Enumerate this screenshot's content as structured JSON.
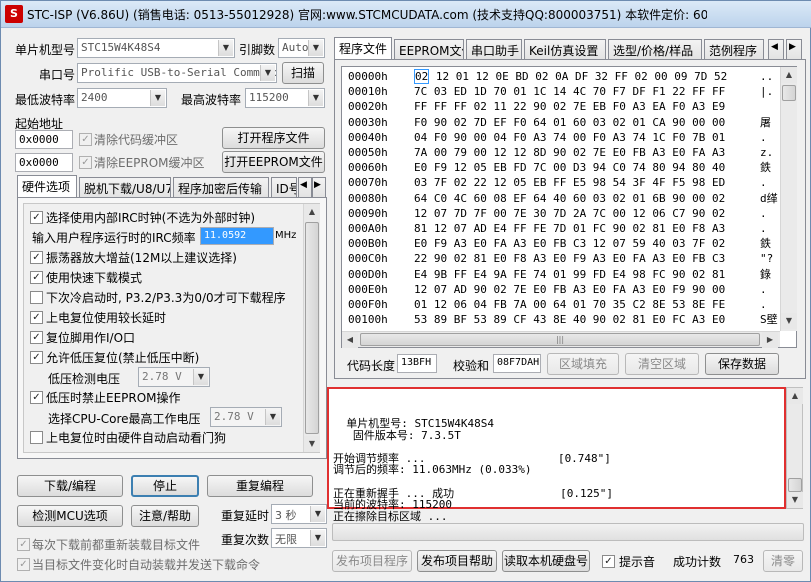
{
  "title": "STC-ISP (V6.86U) (销售电话: 0513-55012928) 官网:www.STCMCUDATA.com (技术支持QQ:800003751) 本软件定价: 60...",
  "title_icon": "stc-logo-icon",
  "left": {
    "mcu_type_label": "单片机型号",
    "mcu_type_value": "STC15W4K48S4",
    "pin_label": "引脚数",
    "pin_value": "Auto",
    "port_label": "串口号",
    "port_value": "Prolific USB-to-Serial Comm Po",
    "scan_button": "扫描",
    "min_baud_label": "最低波特率",
    "min_baud_value": "2400",
    "max_baud_label": "最高波特率",
    "max_baud_value": "115200",
    "start_addr_label": "起始地址",
    "addr1_value": "0x0000",
    "clear_code_label": "清除代码缓冲区",
    "open_program_button": "打开程序文件",
    "addr2_value": "0x0000",
    "clear_eeprom_label": "清除EEPROM缓冲区",
    "open_eeprom_button": "打开EEPROM文件",
    "tabs": [
      "硬件选项",
      "脱机下载/U8/U7",
      "程序加密后传输",
      "ID号"
    ],
    "options": [
      {
        "label": "选择使用内部IRC时钟(不选为外部时钟)",
        "checked": true
      },
      {
        "label": "输入用户程序运行时的IRC频率",
        "freq": "11.0592",
        "unit": "MHz"
      },
      {
        "label": "振荡器放大增益(12M以上建议选择)",
        "checked": true
      },
      {
        "label": "使用快速下载模式",
        "checked": true
      },
      {
        "label": "下次冷启动时, P3.2/P3.3为0/0才可下载程序",
        "checked": false
      },
      {
        "label": "上电复位使用较长延时",
        "checked": true
      },
      {
        "label": "复位脚用作I/O口",
        "checked": true
      },
      {
        "label": "允许低压复位(禁止低压中断)",
        "checked": true
      },
      {
        "label": "低压检测电压",
        "value": "2.78 V"
      },
      {
        "label": "低压时禁止EEPROM操作",
        "checked": true
      },
      {
        "label": "选择CPU-Core最高工作电压",
        "value": "2.78 V"
      },
      {
        "label": "上电复位时由硬件自动启动看门狗",
        "checked": false
      }
    ],
    "download_button": "下载/编程",
    "stop_button": "停止",
    "reprogram_button": "重复编程",
    "detect_button": "检测MCU选项",
    "help_button": "注意/帮助",
    "repeat_delay_label": "重复延时",
    "repeat_delay_value": "3 秒",
    "repeat_count_label": "重复次数",
    "repeat_count_value": "无限",
    "reload_label": "每次下载前都重新装载目标文件",
    "auto_send_label": "当目标文件变化时自动装载并发送下载命令"
  },
  "right": {
    "tabs": [
      "程序文件",
      "EEPROM文件",
      "串口助手",
      "Keil仿真设置",
      "选型/价格/样品",
      "范例程序"
    ],
    "hex_rows": [
      {
        "addr": "00000h",
        "bytes": "02 12 01 12 0E BD 02 0A DF 32 FF 02 00 09 7D 52",
        "ascii": ".."
      },
      {
        "addr": "00010h",
        "bytes": "7C 03 ED 1D 70 01 1C 14 4C 70 F7 DF F1 22 FF FF",
        "ascii": "|."
      },
      {
        "addr": "00020h",
        "bytes": "FF FF FF 02 11 22 90 02 7E EB F0 A3 EA F0 A3 E9",
        "ascii": ""
      },
      {
        "addr": "00030h",
        "bytes": "F0 90 02 7D EF F0 64 01 60 03 02 01 CA 90 00 00",
        "ascii": "屠"
      },
      {
        "addr": "00040h",
        "bytes": "04 F0 90 00 04 F0 A3 74 00 F0 A3 74 1C F0 7B 01",
        "ascii": "."
      },
      {
        "addr": "00050h",
        "bytes": "7A 00 79 00 12 12 8D 90 02 7E E0 FB A3 E0 FA A3",
        "ascii": "z."
      },
      {
        "addr": "00060h",
        "bytes": "E0 F9 12 05 EB FD 7C 00 D3 94 C0 74 80 94 80 40",
        "ascii": "鉄"
      },
      {
        "addr": "00070h",
        "bytes": "03 7F 02 22 12 05 EB FF E5 98 54 3F 4F F5 98 ED",
        "ascii": "."
      },
      {
        "addr": "00080h",
        "bytes": "64 C0 4C 60 08 EF 64 40 60 03 02 01 6B 90 00 02",
        "ascii": "d缂"
      },
      {
        "addr": "00090h",
        "bytes": "12 07 7D 7F 00 7E 30 7D 2A 7C 00 12 06 C7 90 02",
        "ascii": "."
      },
      {
        "addr": "000A0h",
        "bytes": "81 12 07 AD E4 FF FE 7D 01 FC 90 02 81 E0 F8 A3",
        "ascii": "."
      },
      {
        "addr": "000B0h",
        "bytes": "E0 F9 A3 E0 FA A3 E0 FB C3 12 07 59 40 03 7F 02",
        "ascii": "鉄"
      },
      {
        "addr": "000C0h",
        "bytes": "22 90 02 81 E0 F8 A3 E0 F9 A3 E0 FA A3 E0 FB C3",
        "ascii": "\"?"
      },
      {
        "addr": "000D0h",
        "bytes": "E4 9B FF E4 9A FE 74 01 99 FD E4 98 FC 90 02 81",
        "ascii": "錄"
      },
      {
        "addr": "000E0h",
        "bytes": "12 07 AD 90 02 7E E0 FB A3 E0 FA A3 E0 F9 90 00",
        "ascii": "."
      },
      {
        "addr": "000F0h",
        "bytes": "01 12 06 04 FB 7A 00 64 01 70 35 C2 8E 53 8E FE",
        "ascii": "."
      },
      {
        "addr": "00100h",
        "bytes": "53 89 BF 53 89 CF 43 8E 40 90 02 81 E0 FC A3 E0",
        "ascii": "S壁"
      }
    ],
    "code_length_label": "代码长度",
    "code_length_value": "13BFH",
    "checksum_label": "校验和",
    "checksum_value": "08F7DAH",
    "fill_button": "区域填充",
    "clear_button": "清空区域",
    "save_button": "保存数据",
    "log_lines": [
      "  单片机型号: STC15W4K48S4",
      "   固件版本号: 7.3.5T",
      "",
      "开始调节频率 ...                    [0.748\"]",
      "调节后的频率: 11.063MHz (0.033%)",
      "",
      "正在重新握手 ... 成功                [0.125\"]",
      "当前的波特率: 115200",
      "正在擦除目标区域 ..."
    ],
    "publish_project_button": "发布项目程序",
    "publish_help_button": "发布项目帮助",
    "read_disk_button": "读取本机硬盘号",
    "sound_label": "提示音",
    "success_label": "成功计数",
    "success_value": "763",
    "reset_button": "清零"
  },
  "colors": {
    "log_border": "#e03030",
    "selection": "#3399ff"
  }
}
